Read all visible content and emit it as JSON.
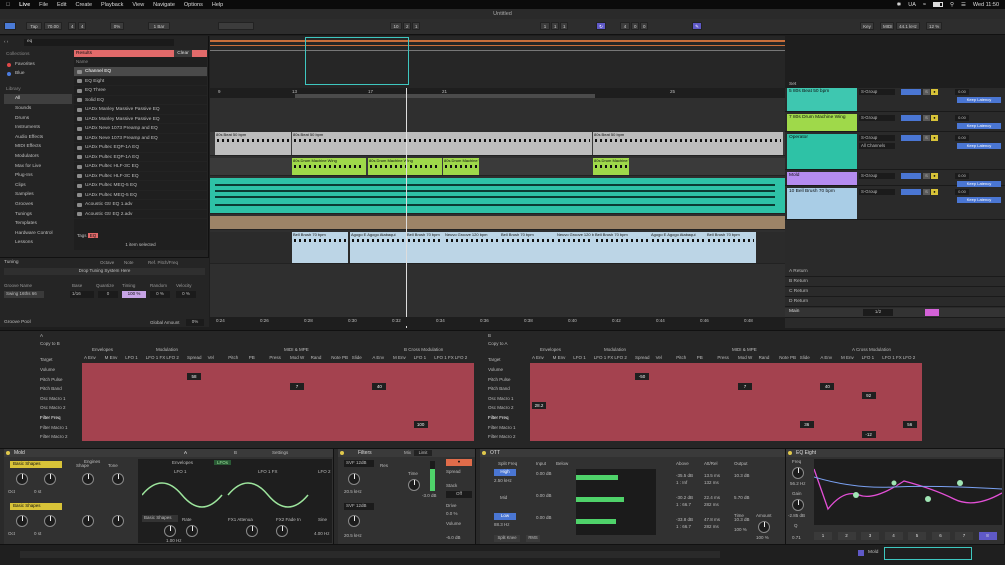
{
  "menubar": {
    "app": "Live",
    "items": [
      "File",
      "Edit",
      "Create",
      "Playback",
      "View",
      "Navigate",
      "Options",
      "Help"
    ],
    "locale": "UA",
    "datetime": "Wed 11:50"
  },
  "window": {
    "title": "Untitled"
  },
  "transport": {
    "tap": "Tap",
    "tempo": "70.00",
    "sig_num": "4",
    "sig_den": "4",
    "metro": "0%",
    "bar": "1 Bar",
    "pos1": "10",
    "pos2": "2",
    "pos3": "1",
    "loop1": "1",
    "loop2": "1",
    "loop3": "1",
    "len1": "4",
    "len2": "0",
    "len3": "0",
    "key": "Key",
    "midi": "MIDI",
    "sr": "44.1 kHz",
    "cpu": "12 %"
  },
  "browser": {
    "search": "eq",
    "collections_label": "Collections",
    "favorites": "Favorites",
    "blue": "Blue",
    "library_label": "Library",
    "categories": [
      "All",
      "Sounds",
      "Drums",
      "Instruments",
      "Audio Effects",
      "MIDI Effects",
      "Modulators",
      "Max for Live",
      "Plug-Ins",
      "Clips",
      "Samples",
      "Grooves",
      "Tunings",
      "Templates"
    ],
    "places": [
      "Hardware Control",
      "Lessons"
    ],
    "results_label": "Results",
    "clear": "Clear",
    "name_col": "Name",
    "results": [
      "Channel EQ",
      "EQ Eight",
      "EQ Three",
      "Solid EQ",
      "UADx Manley Massive Passive EQ",
      "UADx Manley Massive Passive EQ",
      "UADx Neve 1073 Preamp and EQ",
      "UADx Neve 1073 Preamp and EQ",
      "UADx Pultec EQP-1A EQ",
      "UADx Pultec EQP-1A EQ",
      "UADx Pultec HLF-3C EQ",
      "UADx Pultec HLF-3C EQ",
      "UADx Pultec MEQ-5 EQ",
      "UADx Pultec MEQ-5 EQ",
      "Acoustic Gtr EQ 1.adv",
      "Acoustic Gtr EQ 2.adv"
    ],
    "tags_label": "Tags",
    "tags_value": "EQ",
    "selected": "1 item selected"
  },
  "tuning": {
    "title": "Tuning",
    "tonic": "Octave",
    "note": "Note",
    "ref": "Ref. Pitch/Freq",
    "drop": "Drop Tuning System Here"
  },
  "groove": {
    "name_col": "Groove Name",
    "base": "Base",
    "quantize": "Quantize",
    "timing": "Timing",
    "random": "Random",
    "velocity": "Velocity",
    "row_name": "Swing 16ths 66",
    "row_base": "1/16",
    "row_quant": "0",
    "row_timing": "100 %",
    "row_rand": "0 %",
    "row_vel": "0 %",
    "pool": "Groove Pool",
    "global_amount": "Global Amount",
    "global_value": "0%"
  },
  "arrangement": {
    "ruler": [
      "9",
      "13",
      "17",
      "21",
      "25"
    ],
    "times": [
      "0:24",
      "0:26",
      "0:28",
      "0:30",
      "0:32",
      "0:34",
      "0:36",
      "0:38",
      "0:40",
      "0:42",
      "0:44",
      "0:46",
      "0:48"
    ],
    "clips_tr1": [
      "80s Beat 50 bpm",
      "80s Beat 50 bpm",
      "80s Beat 50 bpm"
    ],
    "clips_tr2": [
      "80s Drum Machine Wing",
      "80s Drum Machine Wing",
      "80s Drum Machine Wing",
      "80s Drum Machine Wing"
    ],
    "clips_tr5": [
      "Bell Brush 70 bpm",
      "Agogo E Agogo Atabaqui",
      "Bell Brush 70 bpm",
      "Neuvo Groove 120 bpm",
      "Bell Brush 70 bpm",
      "Neuvo Groove 120 bpm",
      "Bell Brush 70 bpm",
      "Agogo E Agogo Atabaqui",
      "Bell Brush 70 bpm"
    ],
    "zoom": "0.0bt"
  },
  "mixer": {
    "set": "Set",
    "tracks": [
      {
        "name": "5 80s Beat 50 bpm",
        "route": "S-Group",
        "color": "#3ec7b0"
      },
      {
        "name": "7 80s Drum Machine Wing",
        "route": "S-Group",
        "color": "#9fd94a"
      },
      {
        "name": "Operator",
        "route": "S-Group",
        "color": "#2ec2a6",
        "input": "All Channels"
      },
      {
        "name": "Mold",
        "route": "S-Group",
        "color": "#b58cf0"
      },
      {
        "name": "10 Bell Brush 70 bpm",
        "route": "S-Group",
        "color": "#a9cde6"
      }
    ],
    "returns": [
      "A Return",
      "B Return",
      "C Return",
      "D Return"
    ],
    "main": "Main",
    "main_value": "1/2",
    "keep_latency": "Keep Latency",
    "in": "In",
    "auto": "Auto",
    "off": "Off",
    "zero": "0.00"
  },
  "modmatrix": {
    "panels": [
      {
        "title": "A",
        "copy": "Copy to B",
        "target": "Target",
        "rows": [
          "Volume",
          "Pitch Pulse",
          "Pitch Band",
          "Osc Macro 1",
          "Osc Macro 2",
          "Filter Freq",
          "Filter Macro 1",
          "Filter Macro 2"
        ],
        "groups": [
          "Envelopes",
          "Modulation",
          "MIDI & MPE",
          "B Cross Modulation"
        ],
        "cols": [
          "A Env",
          "M Env",
          "LFO 1",
          "LFO 1 FX",
          "LFO 2",
          "Spread",
          "Vel",
          "Pitch",
          "PB",
          "Press",
          "Mod W",
          "Rand",
          "Note PB",
          "Slide",
          "A Env",
          "M Env",
          "LFO 1",
          "LFO 1 FX",
          "LFO 2"
        ],
        "values": [
          "58",
          "7",
          "40",
          "100"
        ]
      },
      {
        "title": "B",
        "copy": "Copy to A",
        "target": "Target",
        "rows": [
          "Volume",
          "Pitch Pulse",
          "Pitch Band",
          "Osc Macro 1",
          "Osc Macro 2",
          "Filter Freq",
          "Filter Macro 1",
          "Filter Macro 2"
        ],
        "groups": [
          "Envelopes",
          "Modulation",
          "MIDI & MPE",
          "A Cross Modulation"
        ],
        "cols": [
          "A Env",
          "M Env",
          "LFO 1",
          "LFO 1 FX",
          "LFO 2",
          "Spread",
          "Vel",
          "Pitch",
          "PB",
          "Press",
          "Mod W",
          "Rand",
          "Note PB",
          "Slide",
          "A Env",
          "M Env",
          "LFO 1",
          "LFO 1 FX",
          "LFO 2"
        ],
        "values": [
          "-50",
          "7",
          "40",
          "28.2",
          "92",
          "57",
          "36",
          "56",
          "-12"
        ]
      }
    ]
  },
  "devices": {
    "mold": {
      "title": "Mold",
      "engines": "Engines",
      "tabA": "A",
      "tabB": "B",
      "settings": "Settings",
      "oscA": "Basic Shapes",
      "oscB": "Basic Shapes",
      "shape": "Shape",
      "tone": "Tone",
      "oct": "Oct",
      "oct_val": "0 st",
      "envelopes": "Envelopes",
      "lfos": "LFOs",
      "lfo1": "LFO 1",
      "lfo1fx": "LFO 1 FX",
      "lfo2": "LFO 2",
      "shapes": "Basic Shapes",
      "rate": "Rate",
      "f1": "FX1 Attenua",
      "f2": "FX2 Fade In",
      "sine": "Sine",
      "rate_val": "1.00 Hz",
      "freq_val": "4.00 Hz"
    },
    "filters": {
      "title": "Filters",
      "mix": "Mix",
      "limit": "Limit",
      "svf1": "SVF 12dB",
      "svf2": "SVF 12dB",
      "freq1": "20.5 kHz",
      "freq2": "20.5 kHz",
      "res": "Res",
      "time": "Time",
      "gain": "-3.0 dB",
      "spread": "Spread",
      "stack": "Stack",
      "off": "Off",
      "drive": "Drive",
      "drive_val": "0.0 %",
      "volume": "Volume",
      "vol_val": "-6.0 dB"
    },
    "ott": {
      "title": "OTT",
      "split": "Split Freq",
      "high": "High",
      "high_val": "2.50 kHz",
      "mid": "Mid",
      "low": "Low",
      "low_val": "88.3 Hz",
      "input": "Input",
      "below": "Below",
      "above": "Above",
      "attrel": "Att/Rel",
      "output": "Output",
      "gain_vals": [
        "-40.0 dB",
        "-41.0 dB",
        "-40.0 dB"
      ],
      "in_vals": [
        "0.00 dB",
        "0.00 dB",
        "0.00 dB"
      ],
      "ratios": [
        "1 : 4.17",
        "1 : 4.17",
        "1 : 4.17"
      ],
      "above_vals": [
        "-35.5 dB",
        "-30.2 dB",
        "-33.8 dB"
      ],
      "above_ratio": [
        "1 : Inf",
        "1 : 66.7",
        "1 : 66.7"
      ],
      "att": [
        "13.5 ms",
        "22.4 ms",
        "47.8 ms"
      ],
      "rel": [
        "132 ms",
        "282 ms",
        "282 ms"
      ],
      "outs": [
        "10.3 dB",
        "5.70 dB",
        "10.3 dB"
      ],
      "time": "Time",
      "time_val": "100 %",
      "amount": "Amount",
      "amount_val": "100 %",
      "gain": "Gain",
      "gain_val": "-2.85 dB",
      "split_btn": "Split Knee",
      "rms": "RMS"
    },
    "eq": {
      "title": "EQ Eight",
      "freq": "Freq",
      "freq_val": "56.2 Hz",
      "gain": "Gain",
      "gain_val": "-2.85 dB",
      "q": "Q",
      "q_val": "0.71",
      "bands": [
        "1",
        "2",
        "3",
        "4",
        "5",
        "6",
        "7",
        "8"
      ]
    }
  },
  "status": {
    "track": "Mold"
  }
}
